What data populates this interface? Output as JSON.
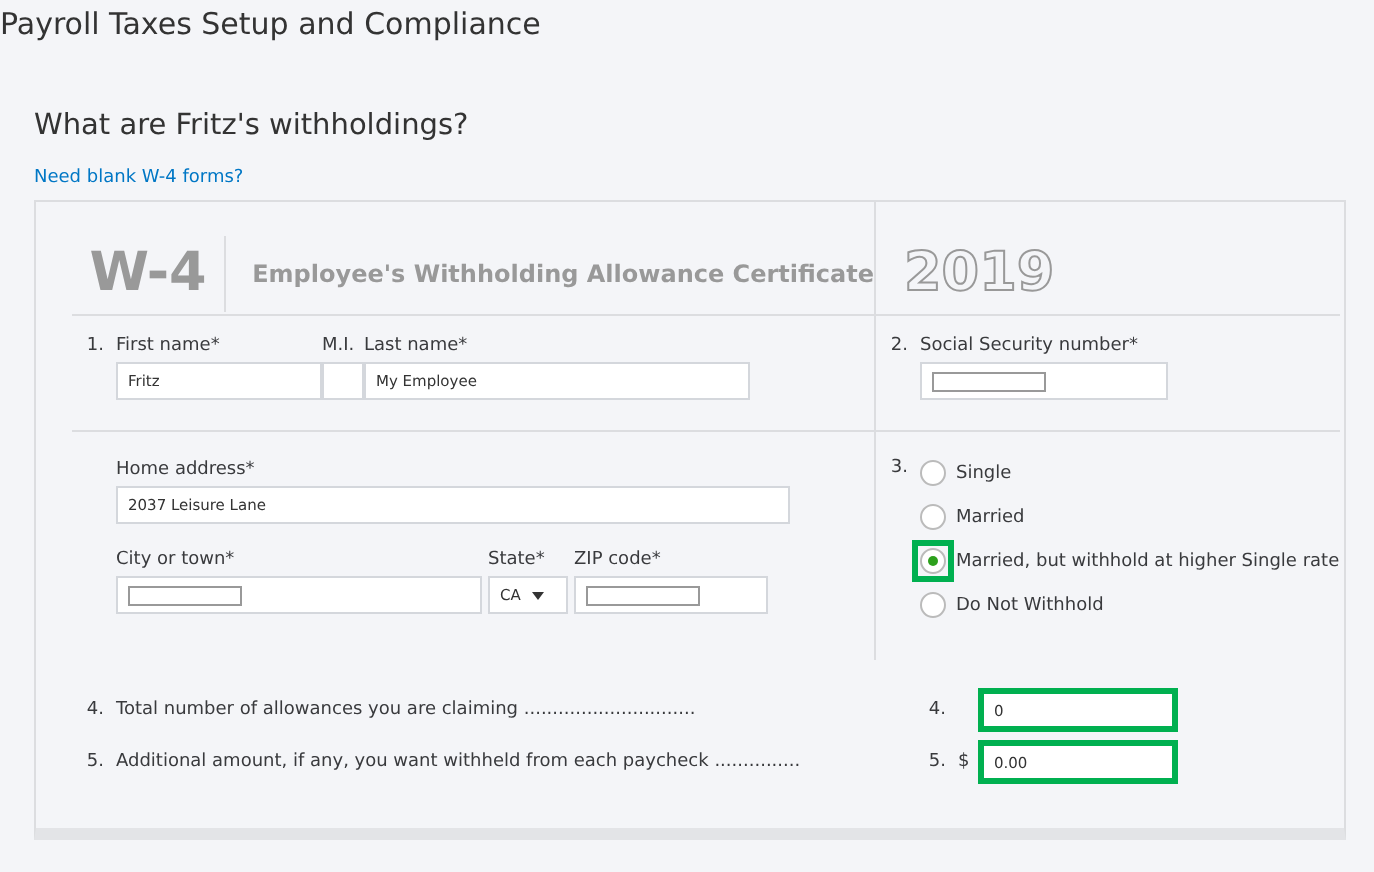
{
  "page_title": "Payroll Taxes Setup and Compliance",
  "heading": "What are Fritz's withholdings?",
  "link": "Need blank W-4 forms?",
  "form": {
    "code": "W-4",
    "title": "Employee's Withholding Allowance Certificate",
    "year": "2019",
    "name_row": {
      "number": "1.",
      "fields": [
        {
          "label": "First name*",
          "value": "Fritz"
        },
        {
          "label": "M.I."
        },
        {
          "label": "Last name*",
          "value": "My Employee"
        }
      ]
    },
    "ssn": {
      "number": "2.",
      "label": "Social Security number*",
      "redacted": true
    },
    "address": {
      "label": "Home address*",
      "value": "2037 Leisure Lane"
    },
    "city": {
      "label": "City or town*",
      "redacted": true
    },
    "state": {
      "label": "State*",
      "value": "CA"
    },
    "zip": {
      "label": "ZIP code*",
      "redacted": true
    },
    "filing_status": {
      "number": "3.",
      "options": [
        {
          "label": "Single",
          "selected": false,
          "highlighted": false
        },
        {
          "label": "Married",
          "selected": false,
          "highlighted": false
        },
        {
          "label": "Married, but withhold at higher Single rate",
          "selected": true,
          "highlighted": true
        },
        {
          "label": "Do Not Withhold",
          "selected": false,
          "highlighted": false
        }
      ]
    },
    "lines": [
      {
        "number": "4.",
        "label": "Total number of allowances you are claiming ..............................",
        "answer_number": "4.",
        "value": "0",
        "highlighted": true
      },
      {
        "number": "5.",
        "label": "Additional amount, if any, you want withheld from each paycheck ...............",
        "answer_number": "5.",
        "prefix": "$",
        "value": "0.00",
        "highlighted": true
      }
    ]
  }
}
